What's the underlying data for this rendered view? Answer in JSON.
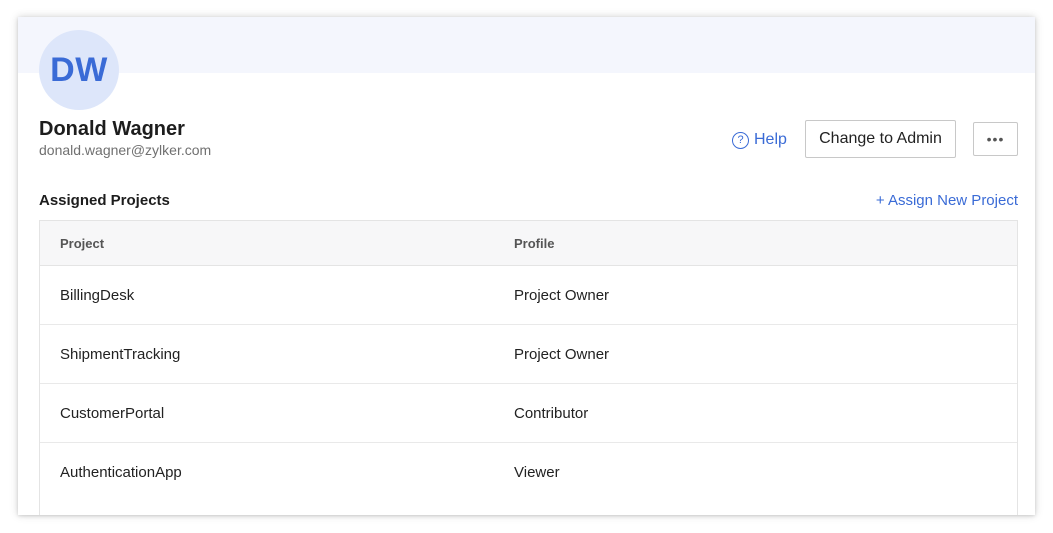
{
  "user": {
    "initials": "DW",
    "name": "Donald Wagner",
    "email": "donald.wagner@zylker.com"
  },
  "actions": {
    "help_label": "Help",
    "change_role_label": "Change to Admin",
    "more_label": "•••"
  },
  "section": {
    "title": "Assigned Projects",
    "assign_label": "+ Assign New Project"
  },
  "table": {
    "columns": [
      "Project",
      "Profile"
    ],
    "rows": [
      {
        "project": "BillingDesk",
        "profile": "Project Owner"
      },
      {
        "project": "ShipmentTracking",
        "profile": "Project Owner"
      },
      {
        "project": "CustomerPortal",
        "profile": "Contributor"
      },
      {
        "project": "AuthenticationApp",
        "profile": "Viewer"
      }
    ]
  },
  "colors": {
    "accent": "#3a6bd6",
    "avatar_bg": "#dde6fa",
    "banner_bg": "#f4f6fd"
  },
  "icons": {
    "help": "question-circle-icon",
    "more": "ellipsis-icon"
  }
}
